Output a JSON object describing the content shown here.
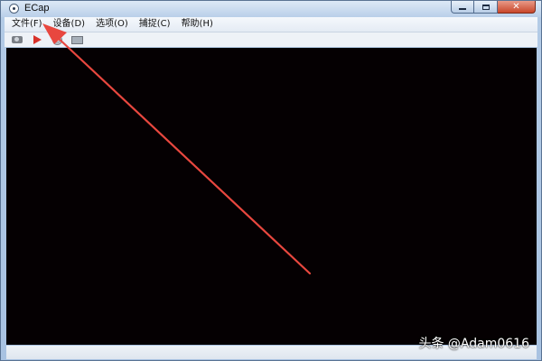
{
  "window": {
    "title": "ECap",
    "icon": "webcam-app-icon"
  },
  "menu": {
    "items": [
      {
        "label": "文件(F)"
      },
      {
        "label": "设备(D)"
      },
      {
        "label": "选项(O)"
      },
      {
        "label": "捕捉(C)"
      },
      {
        "label": "帮助(H)"
      }
    ]
  },
  "toolbar": {
    "buttons": [
      {
        "icon": "camera-icon"
      },
      {
        "icon": "play-icon"
      },
      {
        "icon": "disc-icon"
      },
      {
        "icon": "monitor-icon"
      }
    ]
  },
  "watermark": {
    "text": "头条 @Adam0616"
  },
  "colors": {
    "annotation_arrow": "#e8473f",
    "video_background": "#050002",
    "play_icon": "#d8322a"
  }
}
